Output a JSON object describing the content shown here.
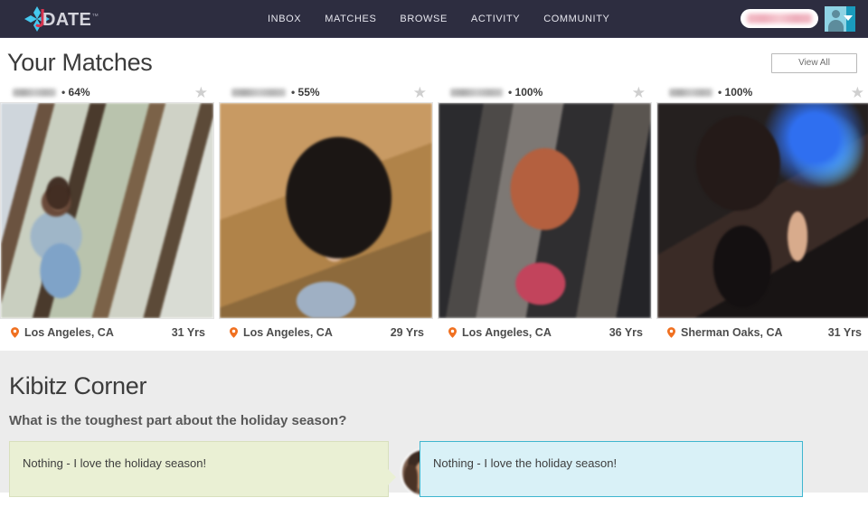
{
  "header": {
    "logo": {
      "mark": "jdate-diamond-icon",
      "letter": "J",
      "text": "DATE",
      "tm": "™"
    },
    "nav": [
      {
        "label": "INBOX"
      },
      {
        "label": "MATCHES"
      },
      {
        "label": "BROWSE"
      },
      {
        "label": "ACTIVITY"
      },
      {
        "label": "COMMUNITY"
      }
    ],
    "upgrade_button": {
      "label": "",
      "note": "text is blurred/redacted in screenshot"
    },
    "account_menu": {
      "icon": "user-avatar-icon",
      "caret": "chevron-down-icon"
    }
  },
  "matches": {
    "title": "Your Matches",
    "view_all_label": "View All",
    "cards": [
      {
        "username": "",
        "separator": "•",
        "match_percent": "64%",
        "location": "Los Angeles, CA",
        "age": "31 Yrs",
        "favorite_icon": "star-icon"
      },
      {
        "username": "",
        "separator": "•",
        "match_percent": "55%",
        "location": "Los Angeles, CA",
        "age": "29 Yrs",
        "favorite_icon": "star-icon"
      },
      {
        "username": "",
        "separator": "•",
        "match_percent": "100%",
        "location": "Los Angeles, CA",
        "age": "36 Yrs",
        "favorite_icon": "star-icon"
      },
      {
        "username": "",
        "separator": "•",
        "match_percent": "100%",
        "location": "Sherman Oaks, CA",
        "age": "31 Yrs",
        "favorite_icon": "star-icon"
      }
    ]
  },
  "kibitz": {
    "title": "Kibitz Corner",
    "question": "What is the toughest part about the holiday season?",
    "answer_left": "Nothing - I love the holiday season!",
    "answer_right": "Nothing - I love the holiday season!"
  },
  "colors": {
    "header_bg": "#2d2d40",
    "accent_pin": "#f07020",
    "logo_blue": "#45c8ef",
    "logo_red": "#d8344f",
    "kibitz_bg": "#ececec",
    "bubble_left_bg": "#eaf0d4",
    "bubble_right_bg": "#d9f1f7",
    "bubble_right_border": "#3fb6cf"
  }
}
